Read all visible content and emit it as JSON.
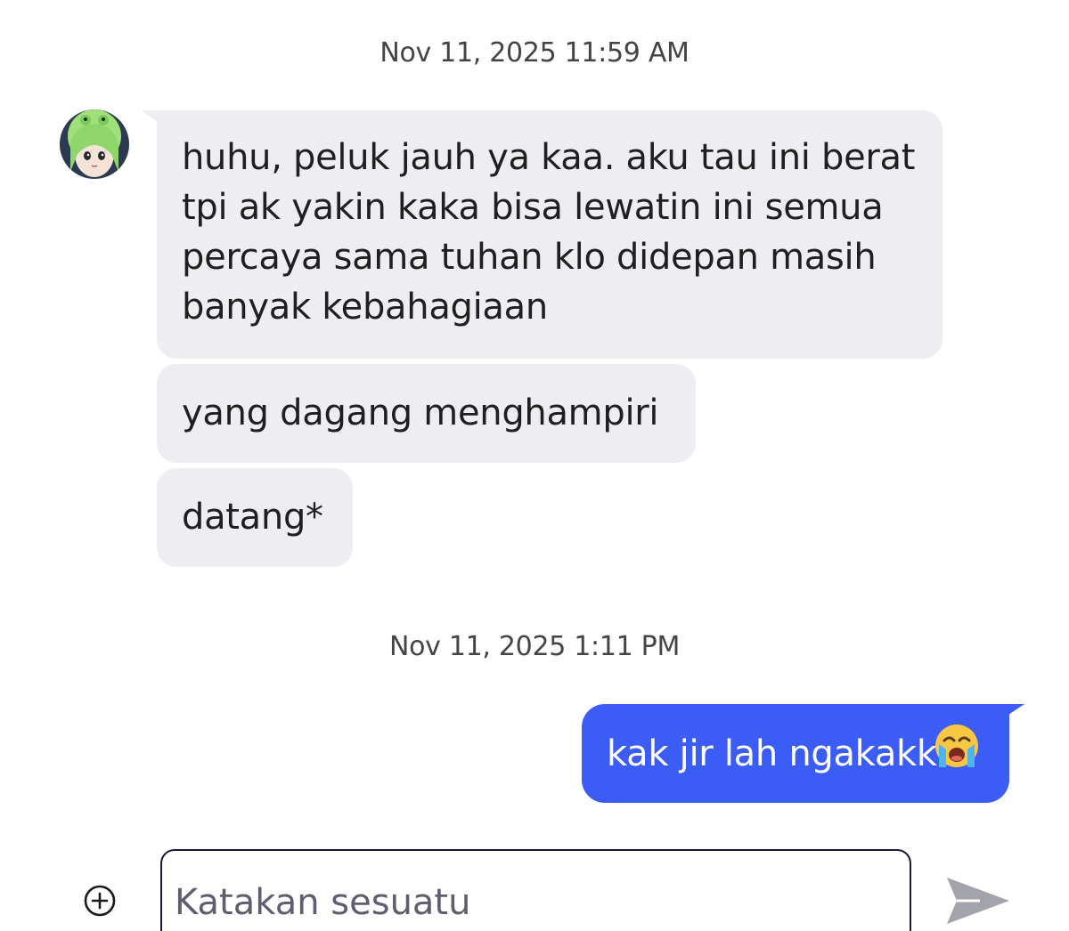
{
  "conversation": {
    "groups": [
      {
        "timestamp": "Nov 11, 2025 11:59 AM",
        "messages": [
          {
            "lines": [
              "huhu, peluk jauh ya kaa. aku tau ini berat",
              "tpi ak yakin kaka bisa lewatin ini semua",
              "percaya sama tuhan klo didepan masih",
              "banyak kebahagiaan"
            ]
          },
          {
            "text": "yang dagang menghampiri"
          },
          {
            "text": "datang*"
          }
        ]
      },
      {
        "timestamp": "Nov 11, 2025 1:11 PM",
        "messages": [
          {
            "text": "kak jir lah ngakakk",
            "emoji": "loudly-crying-face"
          }
        ]
      }
    ]
  },
  "composer": {
    "placeholder": "Katakan sesuatu",
    "add_icon": "plus-circle-icon",
    "send_icon": "send-icon"
  },
  "colors": {
    "received_bubble": "#eeeef2",
    "sent_bubble": "#3b5cf5",
    "timestamp_text": "#444444"
  }
}
